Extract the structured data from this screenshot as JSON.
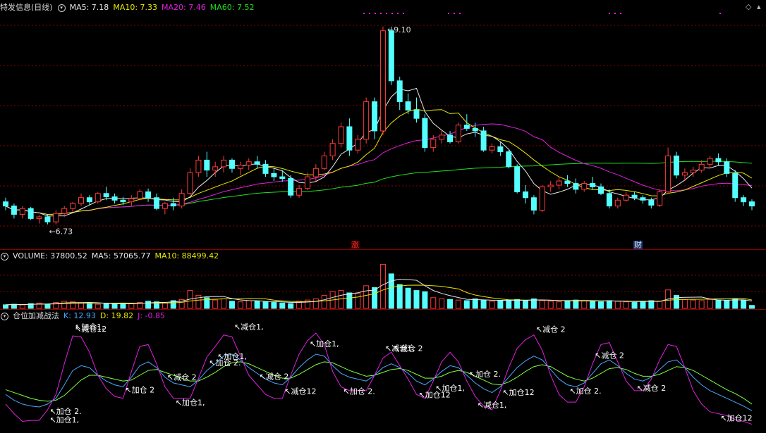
{
  "price_pane": {
    "title": "特发信息(日线)",
    "ma5": "MA5: 7.18",
    "ma10": "MA10: 7.33",
    "ma20": "MA20: 7.46",
    "ma60": "MA60: 7.52",
    "high_label": "9.10",
    "low_label": "6.73",
    "badge_zhang": "涨",
    "badge_cai": "财"
  },
  "volume_pane": {
    "volume": "VOLUME: 37800.52",
    "ma5": "MA5: 57065.77",
    "ma10": "MA10: 88499.42"
  },
  "indicator_pane": {
    "title": "仓位加减战法",
    "k": "K: 12.93",
    "d": "D: 19.82",
    "j": "J: -0.85"
  },
  "signal_labels": [
    "加仓 2.",
    "加仓1,",
    "减仓12",
    "加仓1,",
    "加仓 2",
    "减仓 2",
    "加仓1,",
    "加仓 2.",
    "加仓1,",
    "减仓1,",
    "减仓 2",
    "减仓12",
    "加仓1,",
    "加仓 2.",
    "减仓1,",
    "减仓 2",
    "加仓12",
    "加仓1,",
    "加仓 2.",
    "减仓1,",
    "加仓12",
    "减仓 2",
    "加仓 2.",
    "减仓 2",
    "减仓 2",
    "加仓12"
  ],
  "colors": {
    "up_candle": "#ff3b3b",
    "down_candle": "#54ffff",
    "ma5": "#e8e8e8",
    "ma10": "#e8e800",
    "ma20": "#e020e0",
    "ma60": "#20e020",
    "k_line": "#4aa8ff",
    "d_line": "#80ff40",
    "j_line": "#e020e0",
    "grid": "#8b0000"
  },
  "chart_data": {
    "type": "candlestick",
    "ohlc": [
      [
        7.0,
        7.05,
        6.9,
        6.95
      ],
      [
        6.95,
        6.98,
        6.8,
        6.85
      ],
      [
        6.85,
        6.95,
        6.8,
        6.92
      ],
      [
        6.92,
        6.94,
        6.78,
        6.8
      ],
      [
        6.8,
        6.84,
        6.74,
        6.82
      ],
      [
        6.82,
        6.85,
        6.73,
        6.76
      ],
      [
        6.76,
        6.9,
        6.73,
        6.86
      ],
      [
        6.86,
        6.95,
        6.82,
        6.92
      ],
      [
        6.92,
        7.0,
        6.88,
        6.98
      ],
      [
        6.98,
        7.1,
        6.95,
        7.05
      ],
      [
        7.05,
        7.08,
        6.96,
        7.0
      ],
      [
        7.0,
        7.12,
        6.98,
        7.1
      ],
      [
        7.1,
        7.18,
        7.02,
        7.06
      ],
      [
        7.06,
        7.1,
        6.98,
        7.02
      ],
      [
        7.02,
        7.06,
        6.96,
        7.0
      ],
      [
        7.0,
        7.08,
        6.95,
        7.04
      ],
      [
        7.04,
        7.15,
        7.02,
        7.12
      ],
      [
        7.12,
        7.16,
        7.0,
        7.05
      ],
      [
        7.05,
        7.1,
        6.9,
        6.92
      ],
      [
        6.92,
        7.0,
        6.85,
        6.98
      ],
      [
        6.98,
        7.05,
        6.9,
        6.95
      ],
      [
        6.95,
        7.15,
        6.92,
        7.1
      ],
      [
        7.1,
        7.4,
        7.08,
        7.35
      ],
      [
        7.35,
        7.55,
        7.3,
        7.5
      ],
      [
        7.5,
        7.6,
        7.3,
        7.38
      ],
      [
        7.38,
        7.48,
        7.3,
        7.42
      ],
      [
        7.42,
        7.55,
        7.35,
        7.5
      ],
      [
        7.5,
        7.52,
        7.35,
        7.4
      ],
      [
        7.4,
        7.48,
        7.32,
        7.44
      ],
      [
        7.44,
        7.52,
        7.38,
        7.48
      ],
      [
        7.48,
        7.55,
        7.4,
        7.45
      ],
      [
        7.45,
        7.5,
        7.3,
        7.34
      ],
      [
        7.34,
        7.4,
        7.25,
        7.3
      ],
      [
        7.3,
        7.38,
        7.24,
        7.28
      ],
      [
        7.28,
        7.32,
        7.05,
        7.08
      ],
      [
        7.08,
        7.2,
        7.05,
        7.16
      ],
      [
        7.16,
        7.35,
        7.14,
        7.3
      ],
      [
        7.3,
        7.45,
        7.25,
        7.4
      ],
      [
        7.4,
        7.6,
        7.38,
        7.55
      ],
      [
        7.55,
        7.75,
        7.5,
        7.7
      ],
      [
        7.7,
        7.95,
        7.65,
        7.9
      ],
      [
        7.9,
        8.0,
        7.55,
        7.62
      ],
      [
        7.62,
        7.8,
        7.58,
        7.75
      ],
      [
        7.75,
        8.25,
        7.7,
        8.2
      ],
      [
        8.2,
        8.25,
        7.75,
        7.85
      ],
      [
        7.85,
        9.1,
        7.8,
        9.05
      ],
      [
        9.05,
        9.1,
        8.4,
        8.45
      ],
      [
        8.45,
        8.5,
        8.1,
        8.2
      ],
      [
        8.2,
        8.3,
        8.05,
        8.1
      ],
      [
        8.1,
        8.25,
        7.95,
        8.0
      ],
      [
        8.0,
        8.05,
        7.6,
        7.65
      ],
      [
        7.65,
        7.8,
        7.6,
        7.75
      ],
      [
        7.75,
        7.85,
        7.7,
        7.8
      ],
      [
        7.8,
        7.85,
        7.7,
        7.72
      ],
      [
        7.72,
        7.95,
        7.7,
        7.92
      ],
      [
        7.92,
        8.05,
        7.85,
        7.88
      ],
      [
        7.88,
        7.95,
        7.78,
        7.85
      ],
      [
        7.85,
        7.9,
        7.6,
        7.62
      ],
      [
        7.62,
        7.7,
        7.58,
        7.66
      ],
      [
        7.66,
        7.72,
        7.55,
        7.6
      ],
      [
        7.6,
        7.62,
        7.4,
        7.42
      ],
      [
        7.42,
        7.45,
        7.1,
        7.12
      ],
      [
        7.12,
        7.2,
        6.98,
        7.05
      ],
      [
        7.05,
        7.08,
        6.85,
        6.9
      ],
      [
        6.9,
        7.2,
        6.88,
        7.18
      ],
      [
        7.18,
        7.25,
        7.12,
        7.2
      ],
      [
        7.2,
        7.3,
        7.15,
        7.25
      ],
      [
        7.25,
        7.32,
        7.18,
        7.22
      ],
      [
        7.22,
        7.28,
        7.1,
        7.15
      ],
      [
        7.15,
        7.25,
        7.12,
        7.22
      ],
      [
        7.22,
        7.3,
        7.15,
        7.18
      ],
      [
        7.18,
        7.22,
        7.08,
        7.1
      ],
      [
        7.1,
        7.15,
        6.92,
        6.95
      ],
      [
        6.95,
        7.05,
        6.92,
        7.02
      ],
      [
        7.02,
        7.12,
        7.0,
        7.08
      ],
      [
        7.08,
        7.12,
        7.02,
        7.05
      ],
      [
        7.05,
        7.08,
        6.98,
        7.02
      ],
      [
        7.02,
        7.05,
        6.92,
        6.96
      ],
      [
        6.96,
        7.15,
        6.94,
        7.12
      ],
      [
        7.12,
        7.65,
        7.1,
        7.55
      ],
      [
        7.55,
        7.6,
        7.28,
        7.32
      ],
      [
        7.32,
        7.4,
        7.25,
        7.35
      ],
      [
        7.35,
        7.42,
        7.3,
        7.38
      ],
      [
        7.38,
        7.5,
        7.35,
        7.45
      ],
      [
        7.45,
        7.55,
        7.4,
        7.52
      ],
      [
        7.52,
        7.58,
        7.44,
        7.48
      ],
      [
        7.48,
        7.52,
        7.3,
        7.34
      ],
      [
        7.34,
        7.38,
        7.0,
        7.05
      ],
      [
        7.05,
        7.08,
        6.95,
        7.0
      ],
      [
        7.0,
        7.03,
        6.9,
        6.95
      ]
    ],
    "annotations": {
      "high": 9.1,
      "low": 6.73
    },
    "volume": [
      6,
      7,
      6,
      8,
      9,
      7,
      10,
      12,
      11,
      9,
      8,
      7,
      8,
      7,
      9,
      8,
      10,
      12,
      11,
      9,
      13,
      15,
      30,
      22,
      18,
      14,
      16,
      12,
      11,
      13,
      12,
      11,
      10,
      9,
      8,
      12,
      14,
      16,
      22,
      28,
      30,
      26,
      25,
      38,
      35,
      74,
      58,
      40,
      34,
      30,
      28,
      18,
      16,
      15,
      14,
      13,
      16,
      14,
      12,
      13,
      14,
      15,
      13,
      16,
      13,
      12,
      11,
      12,
      14,
      13,
      12,
      11,
      13,
      12,
      11,
      10,
      12,
      13,
      12,
      31,
      22,
      15,
      14,
      13,
      15,
      14,
      13,
      16,
      14,
      5
    ],
    "kdj": {
      "k": [
        30,
        24,
        20,
        18,
        17,
        20,
        26,
        40,
        55,
        60,
        58,
        50,
        44,
        40,
        38,
        48,
        60,
        64,
        58,
        48,
        42,
        40,
        38,
        45,
        55,
        62,
        70,
        72,
        66,
        58,
        52,
        46,
        42,
        40,
        48,
        58,
        66,
        72,
        70,
        60,
        52,
        48,
        46,
        44,
        50,
        58,
        62,
        58,
        52,
        44,
        40,
        46,
        54,
        60,
        58,
        50,
        42,
        36,
        32,
        38,
        48,
        58,
        65,
        70,
        66,
        56,
        46,
        40,
        38,
        42,
        52,
        62,
        66,
        60,
        52,
        46,
        44,
        48,
        56,
        64,
        66,
        58,
        48,
        40,
        34,
        30,
        26,
        22,
        18,
        13
      ],
      "d": [
        35,
        32,
        29,
        26,
        24,
        23,
        24,
        29,
        37,
        45,
        50,
        50,
        48,
        46,
        44,
        45,
        50,
        55,
        56,
        53,
        50,
        47,
        44,
        44,
        48,
        53,
        59,
        63,
        64,
        62,
        58,
        54,
        50,
        47,
        47,
        51,
        56,
        61,
        64,
        63,
        59,
        55,
        52,
        49,
        50,
        53,
        56,
        57,
        55,
        51,
        47,
        47,
        49,
        53,
        55,
        53,
        49,
        45,
        41,
        40,
        43,
        48,
        54,
        59,
        61,
        59,
        54,
        49,
        46,
        44,
        47,
        52,
        57,
        58,
        56,
        52,
        49,
        49,
        51,
        55,
        59,
        58,
        55,
        50,
        45,
        40,
        35,
        31,
        26,
        20
      ],
      "j": [
        20,
        10,
        2,
        3,
        3,
        14,
        30,
        62,
        91,
        90,
        74,
        50,
        36,
        28,
        26,
        54,
        80,
        82,
        62,
        38,
        26,
        26,
        26,
        47,
        69,
        80,
        92,
        90,
        70,
        50,
        40,
        30,
        26,
        26,
        50,
        72,
        86,
        94,
        82,
        54,
        38,
        34,
        34,
        34,
        50,
        68,
        74,
        60,
        46,
        30,
        26,
        44,
        64,
        74,
        64,
        44,
        28,
        18,
        14,
        34,
        58,
        78,
        87,
        92,
        76,
        50,
        30,
        22,
        22,
        38,
        62,
        82,
        84,
        64,
        44,
        34,
        34,
        46,
        66,
        82,
        80,
        58,
        34,
        20,
        12,
        10,
        8,
        4,
        2,
        -1
      ]
    }
  }
}
